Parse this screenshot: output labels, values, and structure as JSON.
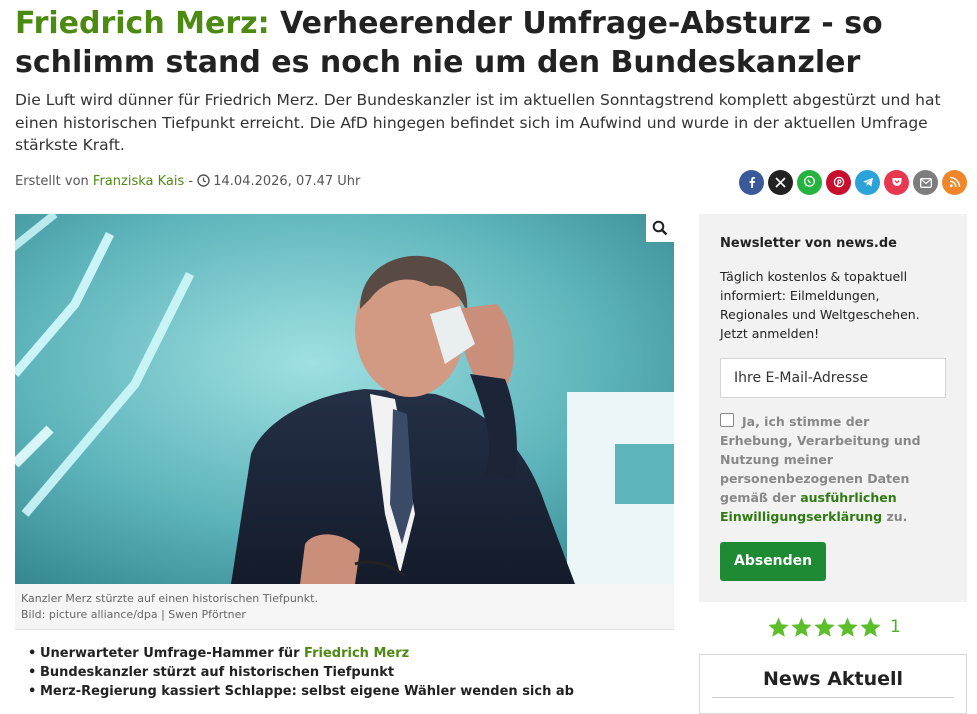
{
  "article": {
    "kicker": "Friedrich Merz:",
    "title": "Verheerender Umfrage-Absturz - so schlimm stand es noch nie um den Bundeskanzler",
    "teaser": "Die Luft wird dünner für Friedrich Merz. Der Bundeskanzler ist im aktuellen Sonntagstrend komplett abgestürzt und hat einen historischen Tiefpunkt erreicht. Die AfD hingegen befindet sich im Aufwind und wurde in der aktuellen Umfrage stärkste Kraft.",
    "byline_prefix": "Erstellt von",
    "author": "Franziska Kais",
    "byline_sep": "-",
    "date": "14.04.2026, 07.47 Uhr",
    "image_caption": "Kanzler Merz stürzte auf einen historischen Tiefpunkt.",
    "image_credit": "Bild: picture alliance/dpa | Swen Pförtner",
    "bullets": [
      {
        "text": "Unerwarteter Umfrage-Hammer für ",
        "link": "Friedrich Merz"
      },
      {
        "text": "Bundeskanzler stürzt auf historischen Tiefpunkt",
        "link": ""
      },
      {
        "text": "Merz-Regierung kassiert Schlappe: selbst eigene Wähler wenden sich ab",
        "link": ""
      }
    ]
  },
  "share": [
    {
      "name": "facebook",
      "color": "#3b5998",
      "icon": "facebook-icon"
    },
    {
      "name": "x",
      "color": "#222222",
      "icon": "x-icon"
    },
    {
      "name": "whatsapp",
      "color": "#25b33f",
      "icon": "whatsapp-icon"
    },
    {
      "name": "pinterest",
      "color": "#c8102e",
      "icon": "pinterest-icon"
    },
    {
      "name": "telegram",
      "color": "#2aa3d8",
      "icon": "telegram-icon"
    },
    {
      "name": "pocket",
      "color": "#e8384f",
      "icon": "pocket-icon"
    },
    {
      "name": "email",
      "color": "#7d7d7d",
      "icon": "mail-icon"
    },
    {
      "name": "rss",
      "color": "#f0862a",
      "icon": "rss-icon"
    }
  ],
  "newsletter": {
    "title": "Newsletter von news.de",
    "text": "Täglich kostenlos & topaktuell informiert: Eilmeldungen, Regionales und Weltgeschehen. Jetzt anmelden!",
    "email_placeholder": "Ihre E-Mail-Adresse",
    "consent_text": "Ja, ich stimme der Erhebung, Verarbeitung und Nutzung meiner personenbezogenen Daten gemäß der",
    "consent_link": "ausführlichen Einwilligungserklärung",
    "consent_suffix": "zu.",
    "submit_label": "Absenden"
  },
  "rating": {
    "stars": 5,
    "count": "1",
    "color": "#5cbf2a"
  },
  "sidebar": {
    "news_title": "News Aktuell"
  },
  "colors": {
    "accent": "#4c8a12",
    "button": "#1f8a34"
  }
}
